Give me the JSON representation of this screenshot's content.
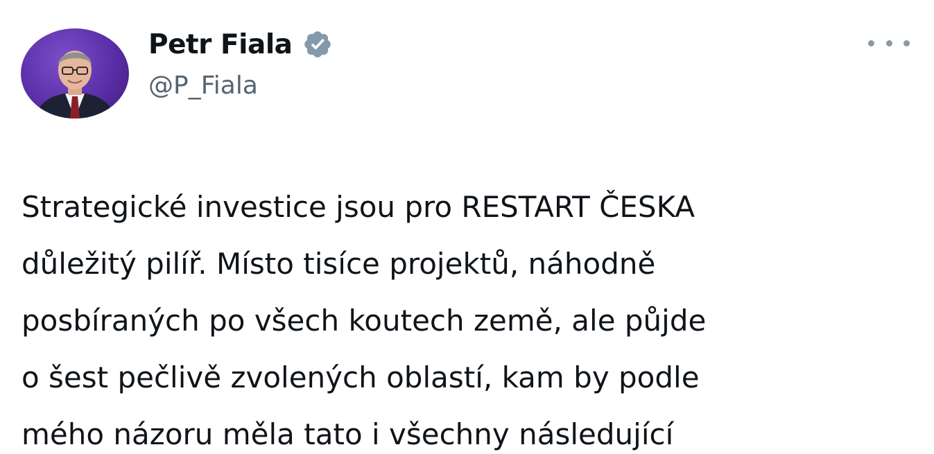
{
  "author": {
    "display_name": "Petr Fiala",
    "handle": "@P_Fiala",
    "verified_icon": "verified-badge-icon",
    "avatar_icon": "profile-photo"
  },
  "menu": {
    "icon": "more-options-icon"
  },
  "tweet": {
    "lines": [
      "Strategické investice jsou pro RESTART ČESKA",
      "důležitý pilíř. Místo tisíce projektů, náhodně",
      "posbíraných po všech koutech země, ale půjde",
      "o šest pečlivě zvolených oblastí, kam by podle",
      "mého názoru měla tato i všechny následující"
    ]
  },
  "colors": {
    "name": "#0f1419",
    "handle": "#536471",
    "verified": "#829aab",
    "avatar_bg": "#5b2fa8",
    "text": "#0f1419"
  }
}
